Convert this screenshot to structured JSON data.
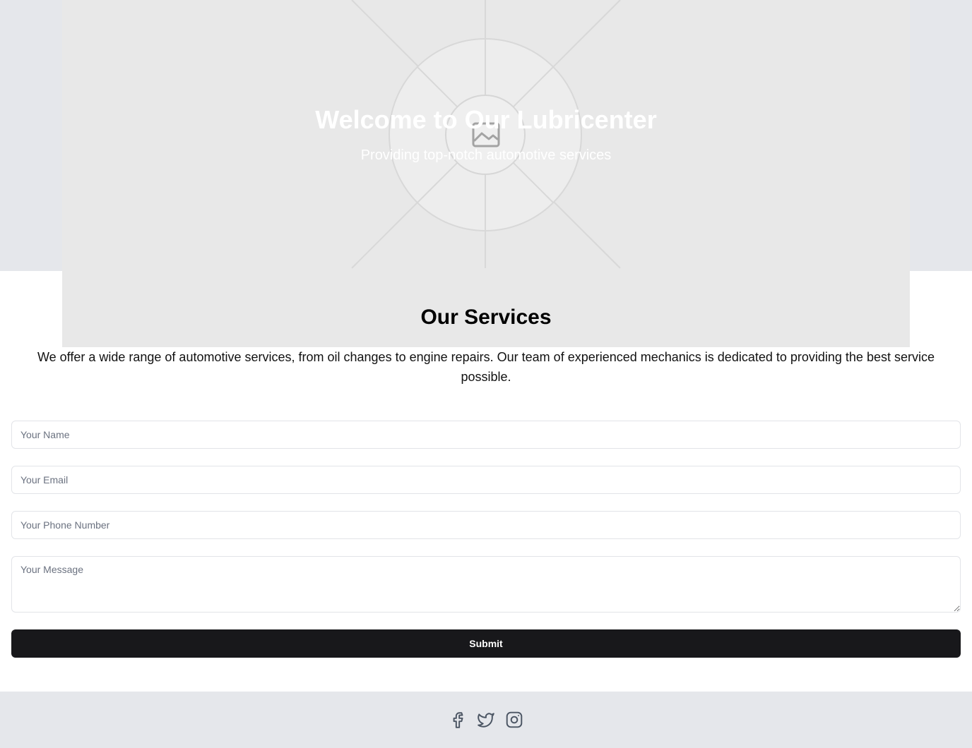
{
  "hero": {
    "title": "Welcome to Our Lubricenter",
    "subtitle": "Providing top-notch automotive services",
    "image_icon": "image-placeholder-icon"
  },
  "services": {
    "title": "Our Services",
    "description": "We offer a wide range of automotive services, from oil changes to engine repairs. Our team of experienced mechanics is dedicated to providing the best service possible."
  },
  "form": {
    "name_placeholder": "Your Name",
    "email_placeholder": "Your Email",
    "phone_placeholder": "Your Phone Number",
    "message_placeholder": "Your Message",
    "submit_label": "Submit"
  },
  "footer": {
    "social_icons": [
      "facebook-icon",
      "twitter-icon",
      "instagram-icon"
    ]
  },
  "colors": {
    "hero_band": "#e5e7eb",
    "button": "#18181b",
    "footer": "#e5e7eb"
  }
}
